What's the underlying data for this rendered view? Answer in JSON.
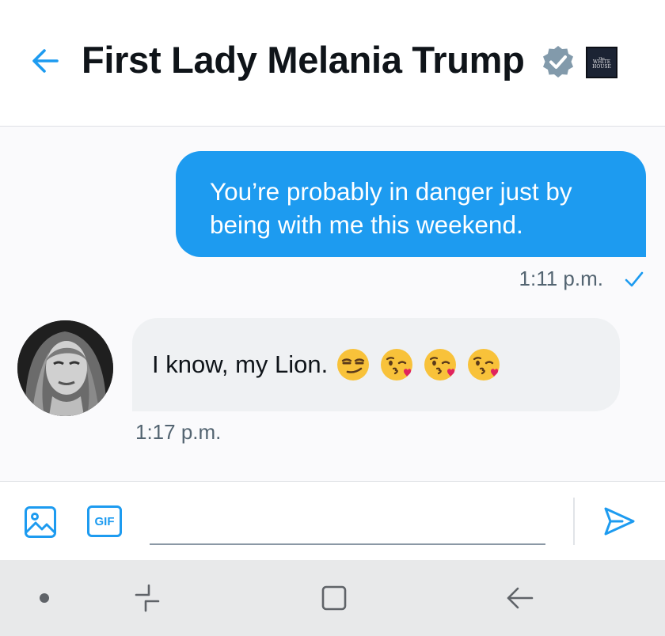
{
  "header": {
    "title": "First Lady Melania Trump",
    "back_icon": "arrow-left-icon",
    "verified_icon": "verified-badge-icon",
    "affiliation": {
      "lines": [
        "The",
        "WHITE",
        "HOUSE"
      ],
      "icon": "white-house-logo"
    }
  },
  "messages": [
    {
      "direction": "outgoing",
      "lines": [
        "You’re probably in danger just by",
        "being with me this weekend."
      ],
      "time": "1:11 p.m.",
      "status_icon": "check-icon"
    },
    {
      "direction": "incoming",
      "text": "I know, my Lion.",
      "emojis": [
        "smirking-face",
        "face-blowing-kiss",
        "face-blowing-kiss",
        "face-blowing-kiss"
      ],
      "time": "1:17 p.m.",
      "avatar": "profile-avatar"
    }
  ],
  "composer": {
    "media_icon": "image-icon",
    "gif_label": "GIF",
    "input_placeholder": "",
    "send_icon": "send-icon"
  },
  "navbar": {
    "items": [
      "dot-icon",
      "recent-apps-icon",
      "home-icon",
      "back-icon"
    ]
  },
  "colors": {
    "accent": "#1d9bf0",
    "outgoing_bubble": "#1d9bf0",
    "incoming_bubble": "#eff1f3",
    "text": "#0f1419",
    "muted_text": "#536471",
    "verified_badge": "#829aab",
    "navbar_bg": "#e8e9ea"
  }
}
